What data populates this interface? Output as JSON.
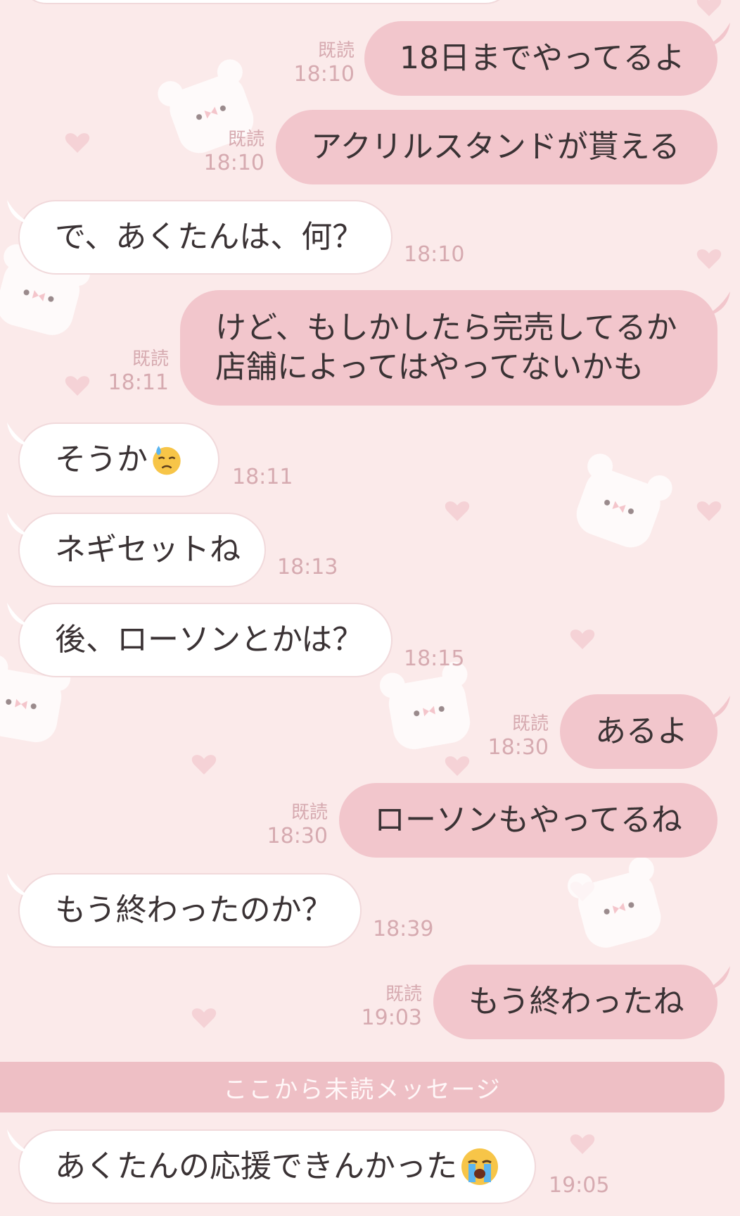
{
  "colors": {
    "background": "#fbeaea",
    "outgoing_bubble": "#f2c6cc",
    "incoming_bubble": "#ffffff",
    "meta_text": "#d6aab0",
    "unread_divider": "#eebfc5"
  },
  "messages": [
    {
      "id": "m1",
      "side": "out",
      "text": "18日までやってるよ",
      "read": "既読",
      "time": "18:10"
    },
    {
      "id": "m2",
      "side": "out",
      "text": "アクリルスタンドが貰える",
      "read": "既読",
      "time": "18:10"
    },
    {
      "id": "m3",
      "side": "in",
      "text": "で、あくたんは、何？",
      "time": "18:10"
    },
    {
      "id": "m4",
      "side": "out",
      "lines": [
        "けど、もしかしたら完売してるか",
        "店舗によってはやってないかも"
      ],
      "read": "既読",
      "time": "18:11"
    },
    {
      "id": "m5",
      "side": "in",
      "text": "そうか",
      "emoji": "downcast-sweat-face-emoji",
      "time": "18:11"
    },
    {
      "id": "m6",
      "side": "in",
      "text": "ネギセットね",
      "time": "18:13"
    },
    {
      "id": "m7",
      "side": "in",
      "text": "後、ローソンとかは？",
      "time": "18:15"
    },
    {
      "id": "m8",
      "side": "out",
      "text": "あるよ",
      "read": "既読",
      "time": "18:30"
    },
    {
      "id": "m9",
      "side": "out",
      "text": "ローソンもやってるね",
      "read": "既読",
      "time": "18:30"
    },
    {
      "id": "m10",
      "side": "in",
      "text": "もう終わったのか？",
      "time": "18:39"
    },
    {
      "id": "m11",
      "side": "out",
      "text": "もう終わったね",
      "read": "既読",
      "time": "19:03"
    },
    {
      "id": "m12",
      "side": "in",
      "text": "あくたんの応援できんかった",
      "emoji": "loudly-crying-face-emoji",
      "time": "19:05"
    }
  ],
  "unread_divider": {
    "label": "ここから未読メッセージ"
  }
}
